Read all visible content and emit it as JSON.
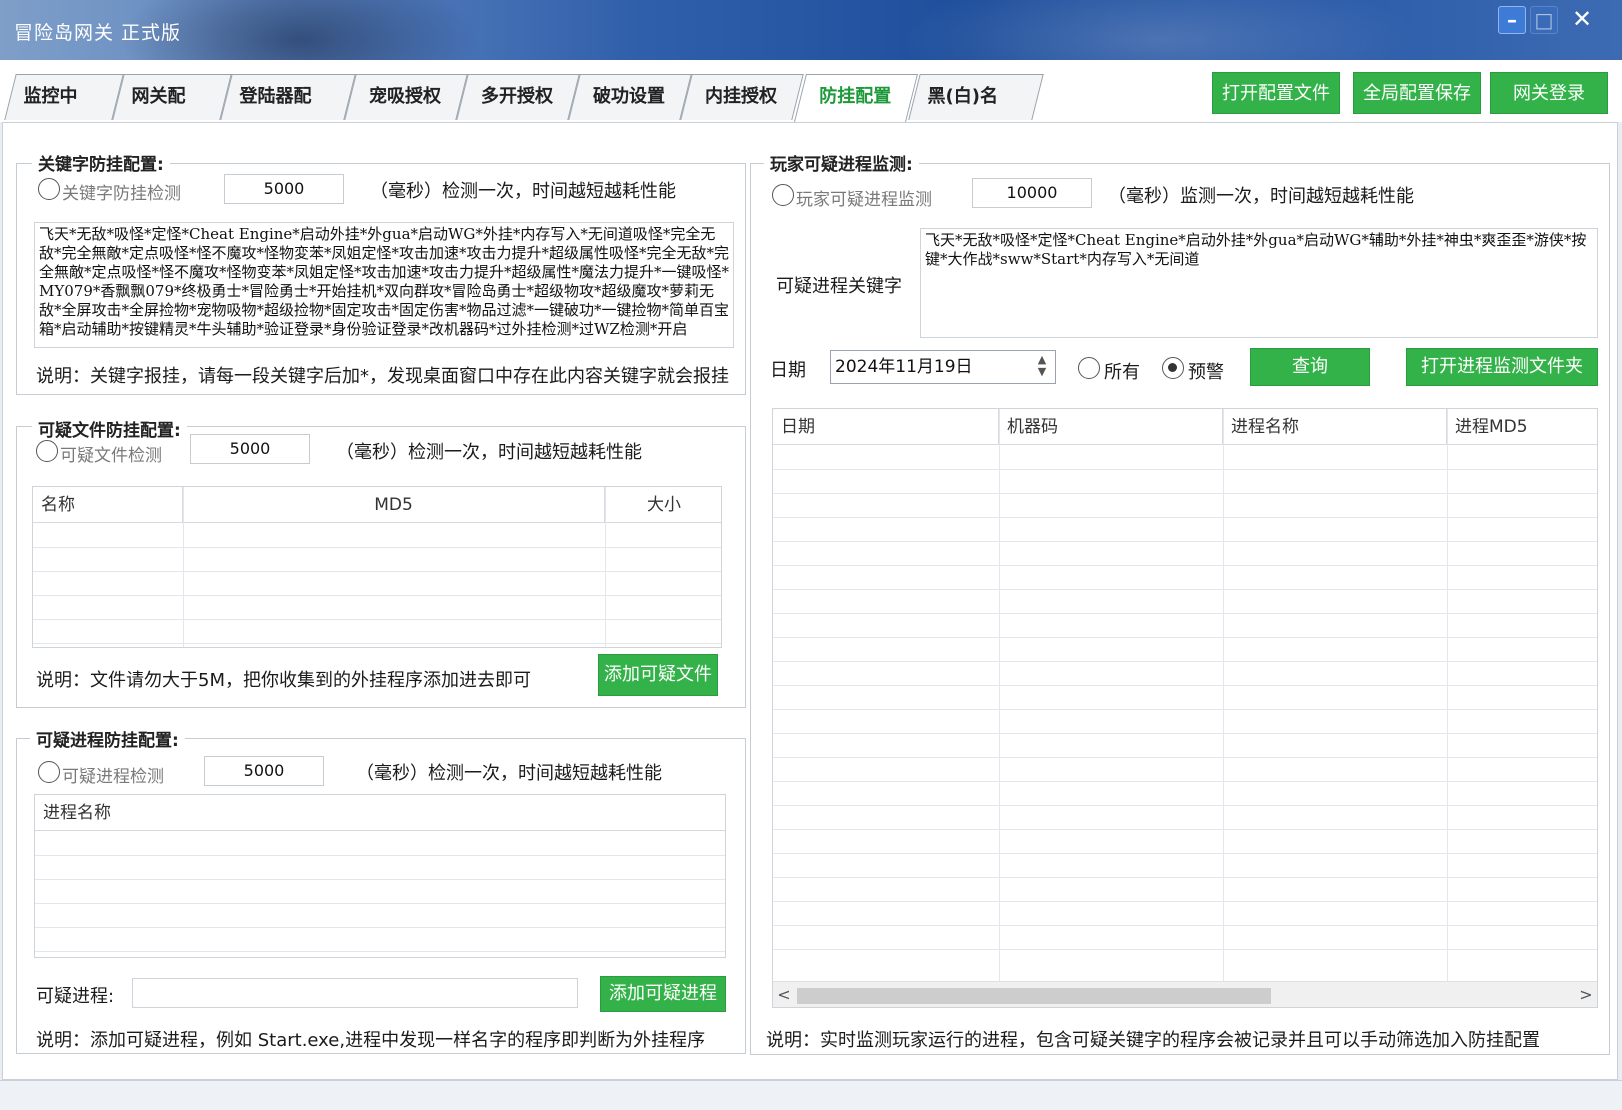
{
  "window": {
    "title": "冒险岛网关 正式版",
    "min_label": "–",
    "max_label": "□",
    "close_label": "✕"
  },
  "tabs": [
    {
      "label": "监控中心",
      "active": false
    },
    {
      "label": "网关配置",
      "active": false
    },
    {
      "label": "登陆器配置",
      "active": false
    },
    {
      "label": "宠吸授权",
      "active": false
    },
    {
      "label": "多开授权",
      "active": false
    },
    {
      "label": "破功设置",
      "active": false
    },
    {
      "label": "内挂授权",
      "active": false
    },
    {
      "label": "防挂配置",
      "active": true
    },
    {
      "label": "黑(白)名单",
      "active": false
    }
  ],
  "toolbar": {
    "open_config": "打开配置文件",
    "save_global": "全局配置保存",
    "gateway_login": "网关登录"
  },
  "keyword": {
    "title": "关键字防挂配置:",
    "radio_label": "关键字防挂检测",
    "checked": false,
    "interval": "5000",
    "interval_note": "（毫秒）检测一次，时间越短越耗性能",
    "keywords": "飞天*无敌*吸怪*定怪*Cheat Engine*启动外挂*外gua*启动WG*外挂*内存写入*无间道吸怪*完全无敌*完全無敵*定点吸怪*怪不魔攻*怪物変苯*凤姐定怪*攻击加速*攻击力提升*超级属性吸怪*完全无敌*完全無敵*定点吸怪*怪不魔攻*怪物变苯*凤姐定怪*攻击加速*攻击力提升*超级属性*魔法力提升*一键吸怪*MY079*香飘飘079*终极勇士*冒险勇士*开始挂机*双向群攻*冒险岛勇士*超级物攻*超级魔攻*萝莉无敌*全屏攻击*全屏捡物*宠物吸物*超级捡物*固定攻击*固定伤害*物品过滤*一键破功*一键捡物*简单百宝箱*启动辅助*按键精灵*牛头辅助*验证登录*身份验证登录*改机器码*过外挂检测*过WZ检测*开启",
    "note": "说明：关键字报挂，请每一段关键字后加*，发现桌面窗口中存在此内容关键字就会报挂"
  },
  "file": {
    "title": "可疑文件防挂配置:",
    "radio_label": "可疑文件检测",
    "checked": false,
    "interval": "5000",
    "interval_note": "（毫秒）检测一次，时间越短越耗性能",
    "columns": [
      "名称",
      "MD5",
      "大小"
    ],
    "note": "说明：文件请勿大于5M，把你收集到的外挂程序添加进去即可",
    "add_button": "添加可疑文件"
  },
  "process": {
    "title": "可疑进程防挂配置:",
    "radio_label": "可疑进程检测",
    "checked": false,
    "interval": "5000",
    "interval_note": "（毫秒）检测一次，时间越短越耗性能",
    "columns": [
      "进程名称"
    ],
    "input_label": "可疑进程:",
    "input_value": "",
    "add_button": "添加可疑进程",
    "note": "说明：添加可疑进程，例如 Start.exe,进程中发现一样名字的程序即判断为外挂程序"
  },
  "monitor": {
    "title": "玩家可疑进程监测:",
    "radio_label": "玩家可疑进程监测",
    "checked": false,
    "interval": "10000",
    "interval_note": "（毫秒）监测一次，时间越短越耗性能",
    "keyword_label": "可疑进程关键字",
    "keywords": "飞天*无敌*吸怪*定怪*Cheat Engine*启动外挂*外gua*启动WG*辅助*外挂*神虫*爽歪歪*游侠*按键*大作战*sww*Start*内存写入*无间道",
    "date_label": "日期",
    "date_value": "2024年11月19日",
    "spin_up": "▲",
    "spin_down": "▼",
    "filter_all": "所有",
    "filter_warn": "预警",
    "filter_selected": "warn",
    "query_button": "查询",
    "open_folder_button": "打开进程监测文件夹",
    "columns": [
      "日期",
      "机器码",
      "进程名称",
      "进程MD5"
    ],
    "scroll_left": "<",
    "scroll_right": ">",
    "note": "说明：实时监测玩家运行的进程，包含可疑关键字的程序会被记录并且可以手动筛选加入防挂配置"
  },
  "colors": {
    "accent_green": "#34b24a",
    "active_tab_text": "#1f9a3a",
    "titlebar_blue": "#2f5eaa"
  }
}
